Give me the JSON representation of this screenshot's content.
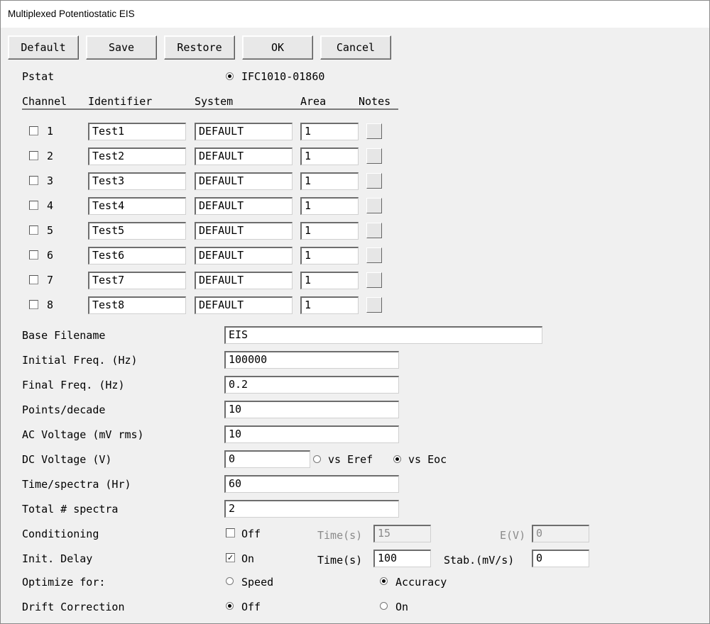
{
  "window": {
    "title": "Multiplexed Potentiostatic EIS"
  },
  "toolbar": {
    "default_label": "Default",
    "save_label": "Save",
    "restore_label": "Restore",
    "ok_label": "OK",
    "cancel_label": "Cancel"
  },
  "pstat": {
    "label": "Pstat",
    "value": "IFC1010-01860",
    "selected": true
  },
  "channels": {
    "headers": {
      "channel": "Channel",
      "identifier": "Identifier",
      "system": "System",
      "area": "Area",
      "notes": "Notes"
    },
    "rows": [
      {
        "number": "1",
        "checked": false,
        "identifier": "Test1",
        "system": "DEFAULT",
        "area": "1"
      },
      {
        "number": "2",
        "checked": false,
        "identifier": "Test2",
        "system": "DEFAULT",
        "area": "1"
      },
      {
        "number": "3",
        "checked": false,
        "identifier": "Test3",
        "system": "DEFAULT",
        "area": "1"
      },
      {
        "number": "4",
        "checked": false,
        "identifier": "Test4",
        "system": "DEFAULT",
        "area": "1"
      },
      {
        "number": "5",
        "checked": false,
        "identifier": "Test5",
        "system": "DEFAULT",
        "area": "1"
      },
      {
        "number": "6",
        "checked": false,
        "identifier": "Test6",
        "system": "DEFAULT",
        "area": "1"
      },
      {
        "number": "7",
        "checked": false,
        "identifier": "Test7",
        "system": "DEFAULT",
        "area": "1"
      },
      {
        "number": "8",
        "checked": false,
        "identifier": "Test8",
        "system": "DEFAULT",
        "area": "1"
      }
    ]
  },
  "params": {
    "base_filename": {
      "label": "Base Filename",
      "value": "EIS"
    },
    "initial_freq": {
      "label": "Initial Freq. (Hz)",
      "value": "100000"
    },
    "final_freq": {
      "label": "Final Freq. (Hz)",
      "value": "0.2"
    },
    "points_decade": {
      "label": "Points/decade",
      "value": "10"
    },
    "ac_voltage": {
      "label": "AC Voltage (mV rms)",
      "value": "10"
    },
    "dc_voltage": {
      "label": "DC Voltage (V)",
      "value": "0",
      "vs_eref_label": "vs Eref",
      "vs_eoc_label": "vs Eoc",
      "selected": "vs Eoc"
    },
    "time_spectra": {
      "label": "Time/spectra (Hr)",
      "value": "60"
    },
    "total_spectra": {
      "label": "Total # spectra",
      "value": "2"
    },
    "conditioning": {
      "label": "Conditioning",
      "checkbox_label": "Off",
      "checked": false,
      "time_label": "Time(s)",
      "time_value": "15",
      "e_label": "E(V)",
      "e_value": "0"
    },
    "init_delay": {
      "label": "Init. Delay",
      "checkbox_label": "On",
      "checked": true,
      "time_label": "Time(s)",
      "time_value": "100",
      "stab_label": "Stab.(mV/s)",
      "stab_value": "0"
    },
    "optimize": {
      "label": "Optimize for:",
      "speed_label": "Speed",
      "accuracy_label": "Accuracy",
      "selected": "Accuracy"
    },
    "drift": {
      "label": "Drift Correction",
      "off_label": "Off",
      "on_label": "On",
      "selected": "Off"
    }
  }
}
